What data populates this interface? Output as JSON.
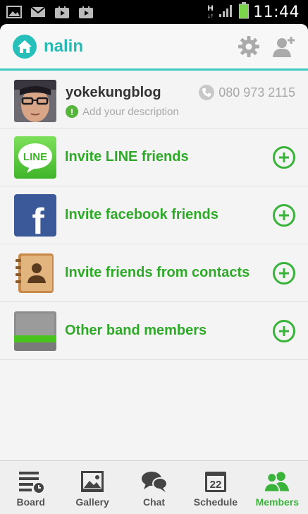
{
  "status_bar": {
    "time": "11:44",
    "network_type": "H",
    "icons": [
      "image-icon",
      "mail-icon",
      "play-store-icon",
      "play-store-icon"
    ]
  },
  "header": {
    "band_name": "nalin",
    "accent_color": "#27bfb9"
  },
  "profile": {
    "name": "yokekungblog",
    "description_placeholder": "Add your description",
    "phone": "080 973 2115"
  },
  "invite_items": [
    {
      "label": "Invite LINE friends",
      "icon": "line-icon",
      "icon_text": "LINE"
    },
    {
      "label": "Invite facebook friends",
      "icon": "facebook-icon",
      "icon_text": "f"
    },
    {
      "label": "Invite friends from contacts",
      "icon": "contacts-book-icon"
    },
    {
      "label": "Other band members",
      "icon": "band-book-icon"
    }
  ],
  "bottom_nav": [
    {
      "label": "Board",
      "icon": "board-icon"
    },
    {
      "label": "Gallery",
      "icon": "gallery-icon"
    },
    {
      "label": "Chat",
      "icon": "chat-icon"
    },
    {
      "label": "Schedule",
      "icon": "calendar-icon",
      "icon_text": "22"
    },
    {
      "label": "Members",
      "icon": "members-icon",
      "active": true
    }
  ],
  "colors": {
    "green": "#3ab33a",
    "teal": "#3ec9c2"
  }
}
